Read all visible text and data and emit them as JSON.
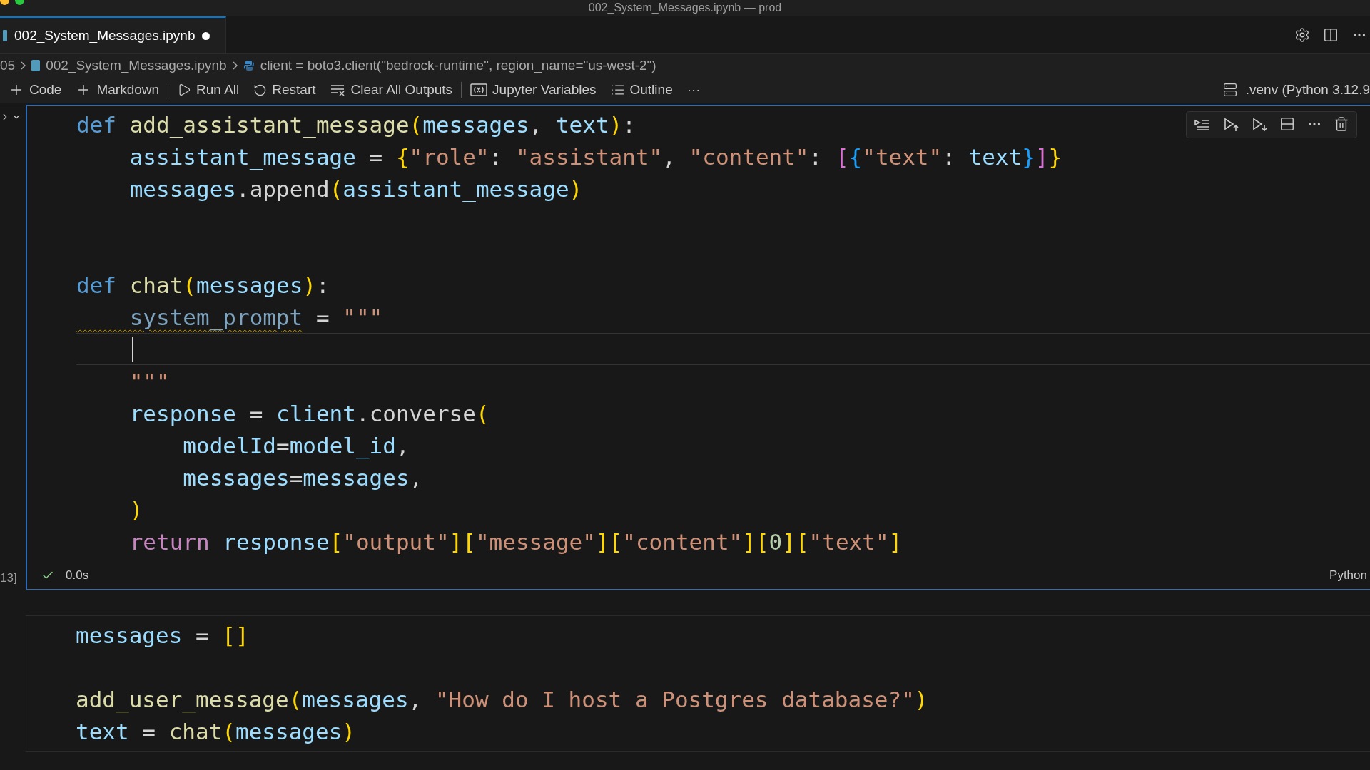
{
  "window": {
    "title": "002_System_Messages.ipynb — prod"
  },
  "tabs": [
    {
      "label": "002_System_Messages.ipynb",
      "selected": true,
      "modified": true
    }
  ],
  "breadcrumb": [
    {
      "kind": "folder",
      "label": "05"
    },
    {
      "kind": "notebook",
      "label": "002_System_Messages.ipynb"
    },
    {
      "kind": "python",
      "label": "client = boto3.client(\"bedrock-runtime\", region_name=\"us-west-2\")"
    }
  ],
  "toolbar": [
    [
      {
        "kind": "plus",
        "label": "Code"
      },
      {
        "kind": "plus",
        "label": "Markdown"
      }
    ],
    [
      {
        "kind": "run",
        "label": "Run All"
      },
      {
        "kind": "restart",
        "label": "Restart"
      },
      {
        "kind": "clear",
        "label": "Clear All Outputs"
      }
    ],
    [
      {
        "kind": "variables",
        "label": "Jupyter Variables"
      },
      {
        "kind": "outline",
        "label": "Outline"
      },
      {
        "kind": "more",
        "label": "···"
      }
    ]
  ],
  "kernel": ".venv (Python 3.12.9",
  "cells": [
    {
      "focused": true,
      "execution": "13]",
      "time": "0.0s",
      "succeeded": true,
      "language": "Python",
      "lines": [
        {
          "cursor": false,
          "tokens": [
            {
              "kind": "kw",
              "text": "def "
            },
            {
              "kind": "fn",
              "text": "add_assistant_message"
            },
            {
              "kind": "b1",
              "text": "("
            },
            {
              "kind": "var",
              "text": "messages"
            },
            {
              "kind": "p",
              "text": ", "
            },
            {
              "kind": "var",
              "text": "text"
            },
            {
              "kind": "b1",
              "text": ")"
            },
            {
              "kind": "p",
              "text": ":"
            }
          ]
        },
        {
          "cursor": false,
          "tokens": [
            {
              "kind": "var",
              "text": "    assistant_message"
            },
            {
              "kind": "p",
              "text": " = "
            },
            {
              "kind": "b1",
              "text": "{"
            },
            {
              "kind": "str",
              "text": "\"role\""
            },
            {
              "kind": "p",
              "text": ": "
            },
            {
              "kind": "str",
              "text": "\"assistant\""
            },
            {
              "kind": "p",
              "text": ", "
            },
            {
              "kind": "str",
              "text": "\"content\""
            },
            {
              "kind": "p",
              "text": ": "
            },
            {
              "kind": "b2",
              "text": "["
            },
            {
              "kind": "b3",
              "text": "{"
            },
            {
              "kind": "str",
              "text": "\"text\""
            },
            {
              "kind": "p",
              "text": ": "
            },
            {
              "kind": "var",
              "text": "text"
            },
            {
              "kind": "b3",
              "text": "}"
            },
            {
              "kind": "b2",
              "text": "]"
            },
            {
              "kind": "b1",
              "text": "}"
            }
          ]
        },
        {
          "cursor": false,
          "tokens": [
            {
              "kind": "var",
              "text": "    messages"
            },
            {
              "kind": "p",
              "text": "."
            },
            {
              "kind": "method",
              "text": "append"
            },
            {
              "kind": "b1",
              "text": "("
            },
            {
              "kind": "var",
              "text": "assistant_message"
            },
            {
              "kind": "b1",
              "text": ")"
            }
          ]
        },
        {
          "cursor": false
        },
        {
          "cursor": false
        },
        {
          "cursor": false,
          "tokens": [
            {
              "kind": "kw",
              "text": "def "
            },
            {
              "kind": "fn",
              "text": "chat"
            },
            {
              "kind": "b1",
              "text": "("
            },
            {
              "kind": "var",
              "text": "messages"
            },
            {
              "kind": "b1",
              "text": ")"
            },
            {
              "kind": "p",
              "text": ":"
            }
          ]
        },
        {
          "cursor": false,
          "tokens": [
            {
              "kind": "unused",
              "text": "    system_prompt"
            },
            {
              "kind": "p",
              "text": " = "
            },
            {
              "kind": "str",
              "text": "\"\"\""
            }
          ]
        },
        {
          "cursor": true
        },
        {
          "cursor": false,
          "tokens": [
            {
              "kind": "str",
              "text": "    \"\"\""
            }
          ]
        },
        {
          "cursor": false,
          "tokens": [
            {
              "kind": "var",
              "text": "    response"
            },
            {
              "kind": "p",
              "text": " = "
            },
            {
              "kind": "var",
              "text": "client"
            },
            {
              "kind": "p",
              "text": "."
            },
            {
              "kind": "method",
              "text": "converse"
            },
            {
              "kind": "b1",
              "text": "("
            }
          ]
        },
        {
          "cursor": false,
          "tokens": [
            {
              "kind": "var",
              "text": "        modelId"
            },
            {
              "kind": "p",
              "text": "="
            },
            {
              "kind": "var",
              "text": "model_id"
            },
            {
              "kind": "p",
              "text": ","
            }
          ]
        },
        {
          "cursor": false,
          "tokens": [
            {
              "kind": "var",
              "text": "        messages"
            },
            {
              "kind": "p",
              "text": "="
            },
            {
              "kind": "var",
              "text": "messages"
            },
            {
              "kind": "p",
              "text": ","
            }
          ]
        },
        {
          "cursor": false,
          "tokens": [
            {
              "kind": "b1",
              "text": "    )"
            }
          ]
        },
        {
          "cursor": false,
          "tokens": [
            {
              "kind": "ctrl",
              "text": "    return "
            },
            {
              "kind": "var",
              "text": "response"
            },
            {
              "kind": "b1",
              "text": "["
            },
            {
              "kind": "str",
              "text": "\"output\""
            },
            {
              "kind": "b1",
              "text": "]["
            },
            {
              "kind": "str",
              "text": "\"message\""
            },
            {
              "kind": "b1",
              "text": "]["
            },
            {
              "kind": "str",
              "text": "\"content\""
            },
            {
              "kind": "b1",
              "text": "]["
            },
            {
              "kind": "num",
              "text": "0"
            },
            {
              "kind": "b1",
              "text": "]["
            },
            {
              "kind": "str",
              "text": "\"text\""
            },
            {
              "kind": "b1",
              "text": "]"
            }
          ]
        }
      ]
    },
    {
      "focused": false,
      "lines": [
        {
          "cursor": false,
          "tokens": [
            {
              "kind": "var",
              "text": "messages"
            },
            {
              "kind": "p",
              "text": " = "
            },
            {
              "kind": "b1",
              "text": "[]"
            }
          ]
        },
        {
          "cursor": false
        },
        {
          "cursor": false,
          "tokens": [
            {
              "kind": "fn",
              "text": "add_user_message"
            },
            {
              "kind": "b1",
              "text": "("
            },
            {
              "kind": "var",
              "text": "messages"
            },
            {
              "kind": "p",
              "text": ", "
            },
            {
              "kind": "str",
              "text": "\"How do I host a Postgres database?\""
            },
            {
              "kind": "b1",
              "text": ")"
            }
          ]
        },
        {
          "cursor": false,
          "tokens": [
            {
              "kind": "var",
              "text": "text"
            },
            {
              "kind": "p",
              "text": " = "
            },
            {
              "kind": "fn",
              "text": "chat"
            },
            {
              "kind": "b1",
              "text": "("
            },
            {
              "kind": "var",
              "text": "messages"
            },
            {
              "kind": "b1",
              "text": ")"
            }
          ]
        }
      ]
    }
  ]
}
